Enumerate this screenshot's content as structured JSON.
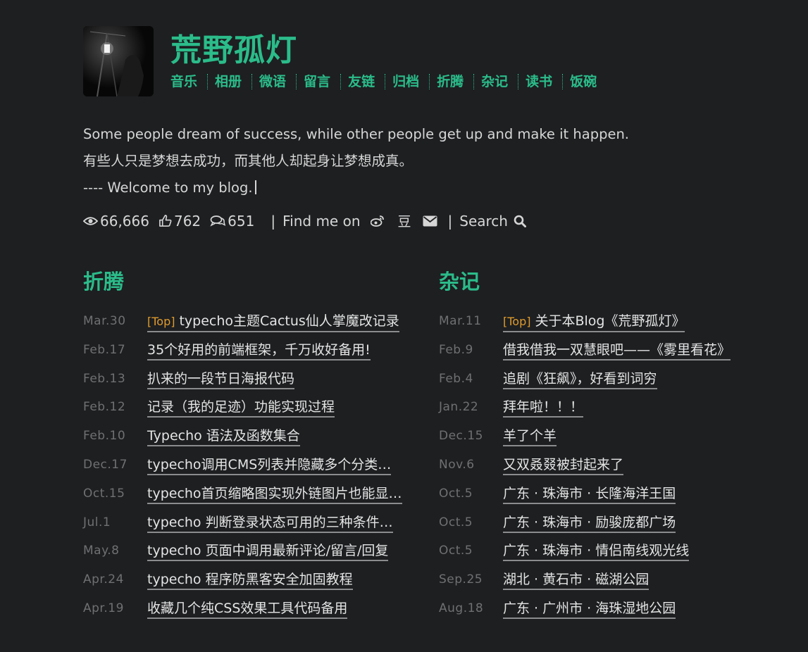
{
  "header": {
    "title": "荒野孤灯",
    "nav": [
      "音乐",
      "相册",
      "微语",
      "留言",
      "友链",
      "归档",
      "折腾",
      "杂记",
      "读书",
      "饭碗"
    ]
  },
  "description": {
    "line1": "Some people dream of success, while other people get up and make it happen.",
    "line2": "有些人只是梦想去成功，而其他人却起身让梦想成真。",
    "line3": "---- Welcome to my blog."
  },
  "meta": {
    "views": "66,666",
    "likes": "762",
    "comments": "651",
    "find_me": "Find me on",
    "douban": "豆",
    "search": "Search"
  },
  "columns": [
    {
      "title": "折腾",
      "posts": [
        {
          "date": "Mar.30",
          "tag": "[Top]",
          "title": "typecho主题Cactus仙人掌魔改记录"
        },
        {
          "date": "Feb.17",
          "title": "35个好用的前端框架，千万收好备用!"
        },
        {
          "date": "Feb.13",
          "title": "扒来的一段节日海报代码"
        },
        {
          "date": "Feb.12",
          "title": "记录（我的足迹）功能实现过程"
        },
        {
          "date": "Feb.10",
          "title": "Typecho 语法及函数集合"
        },
        {
          "date": "Dec.17",
          "title": "typecho调用CMS列表并隐藏多个分类…"
        },
        {
          "date": "Oct.15",
          "title": "typecho首页缩略图实现外链图片也能显…"
        },
        {
          "date": "Jul.1",
          "title": "typecho 判断登录状态可用的三种条件…"
        },
        {
          "date": "May.8",
          "title": "typecho 页面中调用最新评论/留言/回复"
        },
        {
          "date": "Apr.24",
          "title": "typecho 程序防黑客安全加固教程"
        },
        {
          "date": "Apr.19",
          "title": "收藏几个纯CSS效果工具代码备用"
        }
      ]
    },
    {
      "title": "杂记",
      "posts": [
        {
          "date": "Mar.11",
          "tag": "[Top]",
          "title": "关于本Blog《荒野孤灯》"
        },
        {
          "date": "Feb.9",
          "title": "借我借我一双慧眼吧——《雾里看花》"
        },
        {
          "date": "Feb.4",
          "title": "追剧《狂飙》，好看到词穷"
        },
        {
          "date": "Jan.22",
          "title": "拜年啦！！！"
        },
        {
          "date": "Dec.15",
          "title": "羊了个羊"
        },
        {
          "date": "Nov.6",
          "title": "又双叒叕被封起来了"
        },
        {
          "date": "Oct.5",
          "title": "广东 · 珠海市 · 长隆海洋王国"
        },
        {
          "date": "Oct.5",
          "title": "广东 · 珠海市 · 励骏庞都广场"
        },
        {
          "date": "Oct.5",
          "title": "广东 · 珠海市 · 情侣南线观光线"
        },
        {
          "date": "Sep.25",
          "title": "湖北 · 黄石市 · 磁湖公园"
        },
        {
          "date": "Aug.18",
          "title": "广东 · 广州市 · 海珠湿地公园"
        }
      ]
    }
  ]
}
